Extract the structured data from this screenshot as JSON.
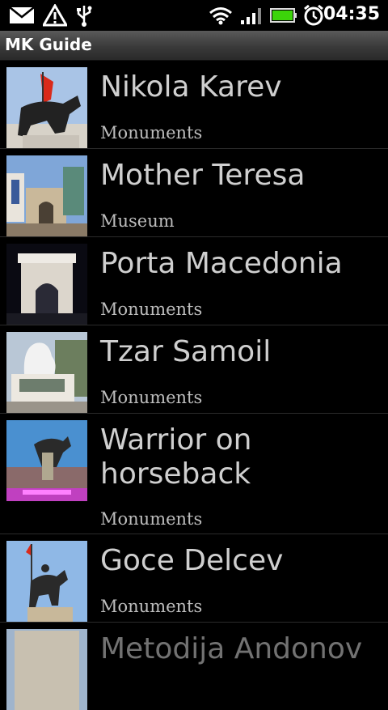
{
  "status": {
    "time": "04:35"
  },
  "app": {
    "title": "MK Guide"
  },
  "items": [
    {
      "name": "Nikola Karev",
      "category": "Monuments"
    },
    {
      "name": "Mother Teresa",
      "category": "Museum"
    },
    {
      "name": "Porta Macedonia",
      "category": "Monuments"
    },
    {
      "name": "Tzar Samoil",
      "category": "Monuments"
    },
    {
      "name": "Warrior on horseback",
      "category": "Monuments"
    },
    {
      "name": "Goce Delcev",
      "category": "Monuments"
    },
    {
      "name": "Metodija Andonov",
      "category": ""
    }
  ]
}
